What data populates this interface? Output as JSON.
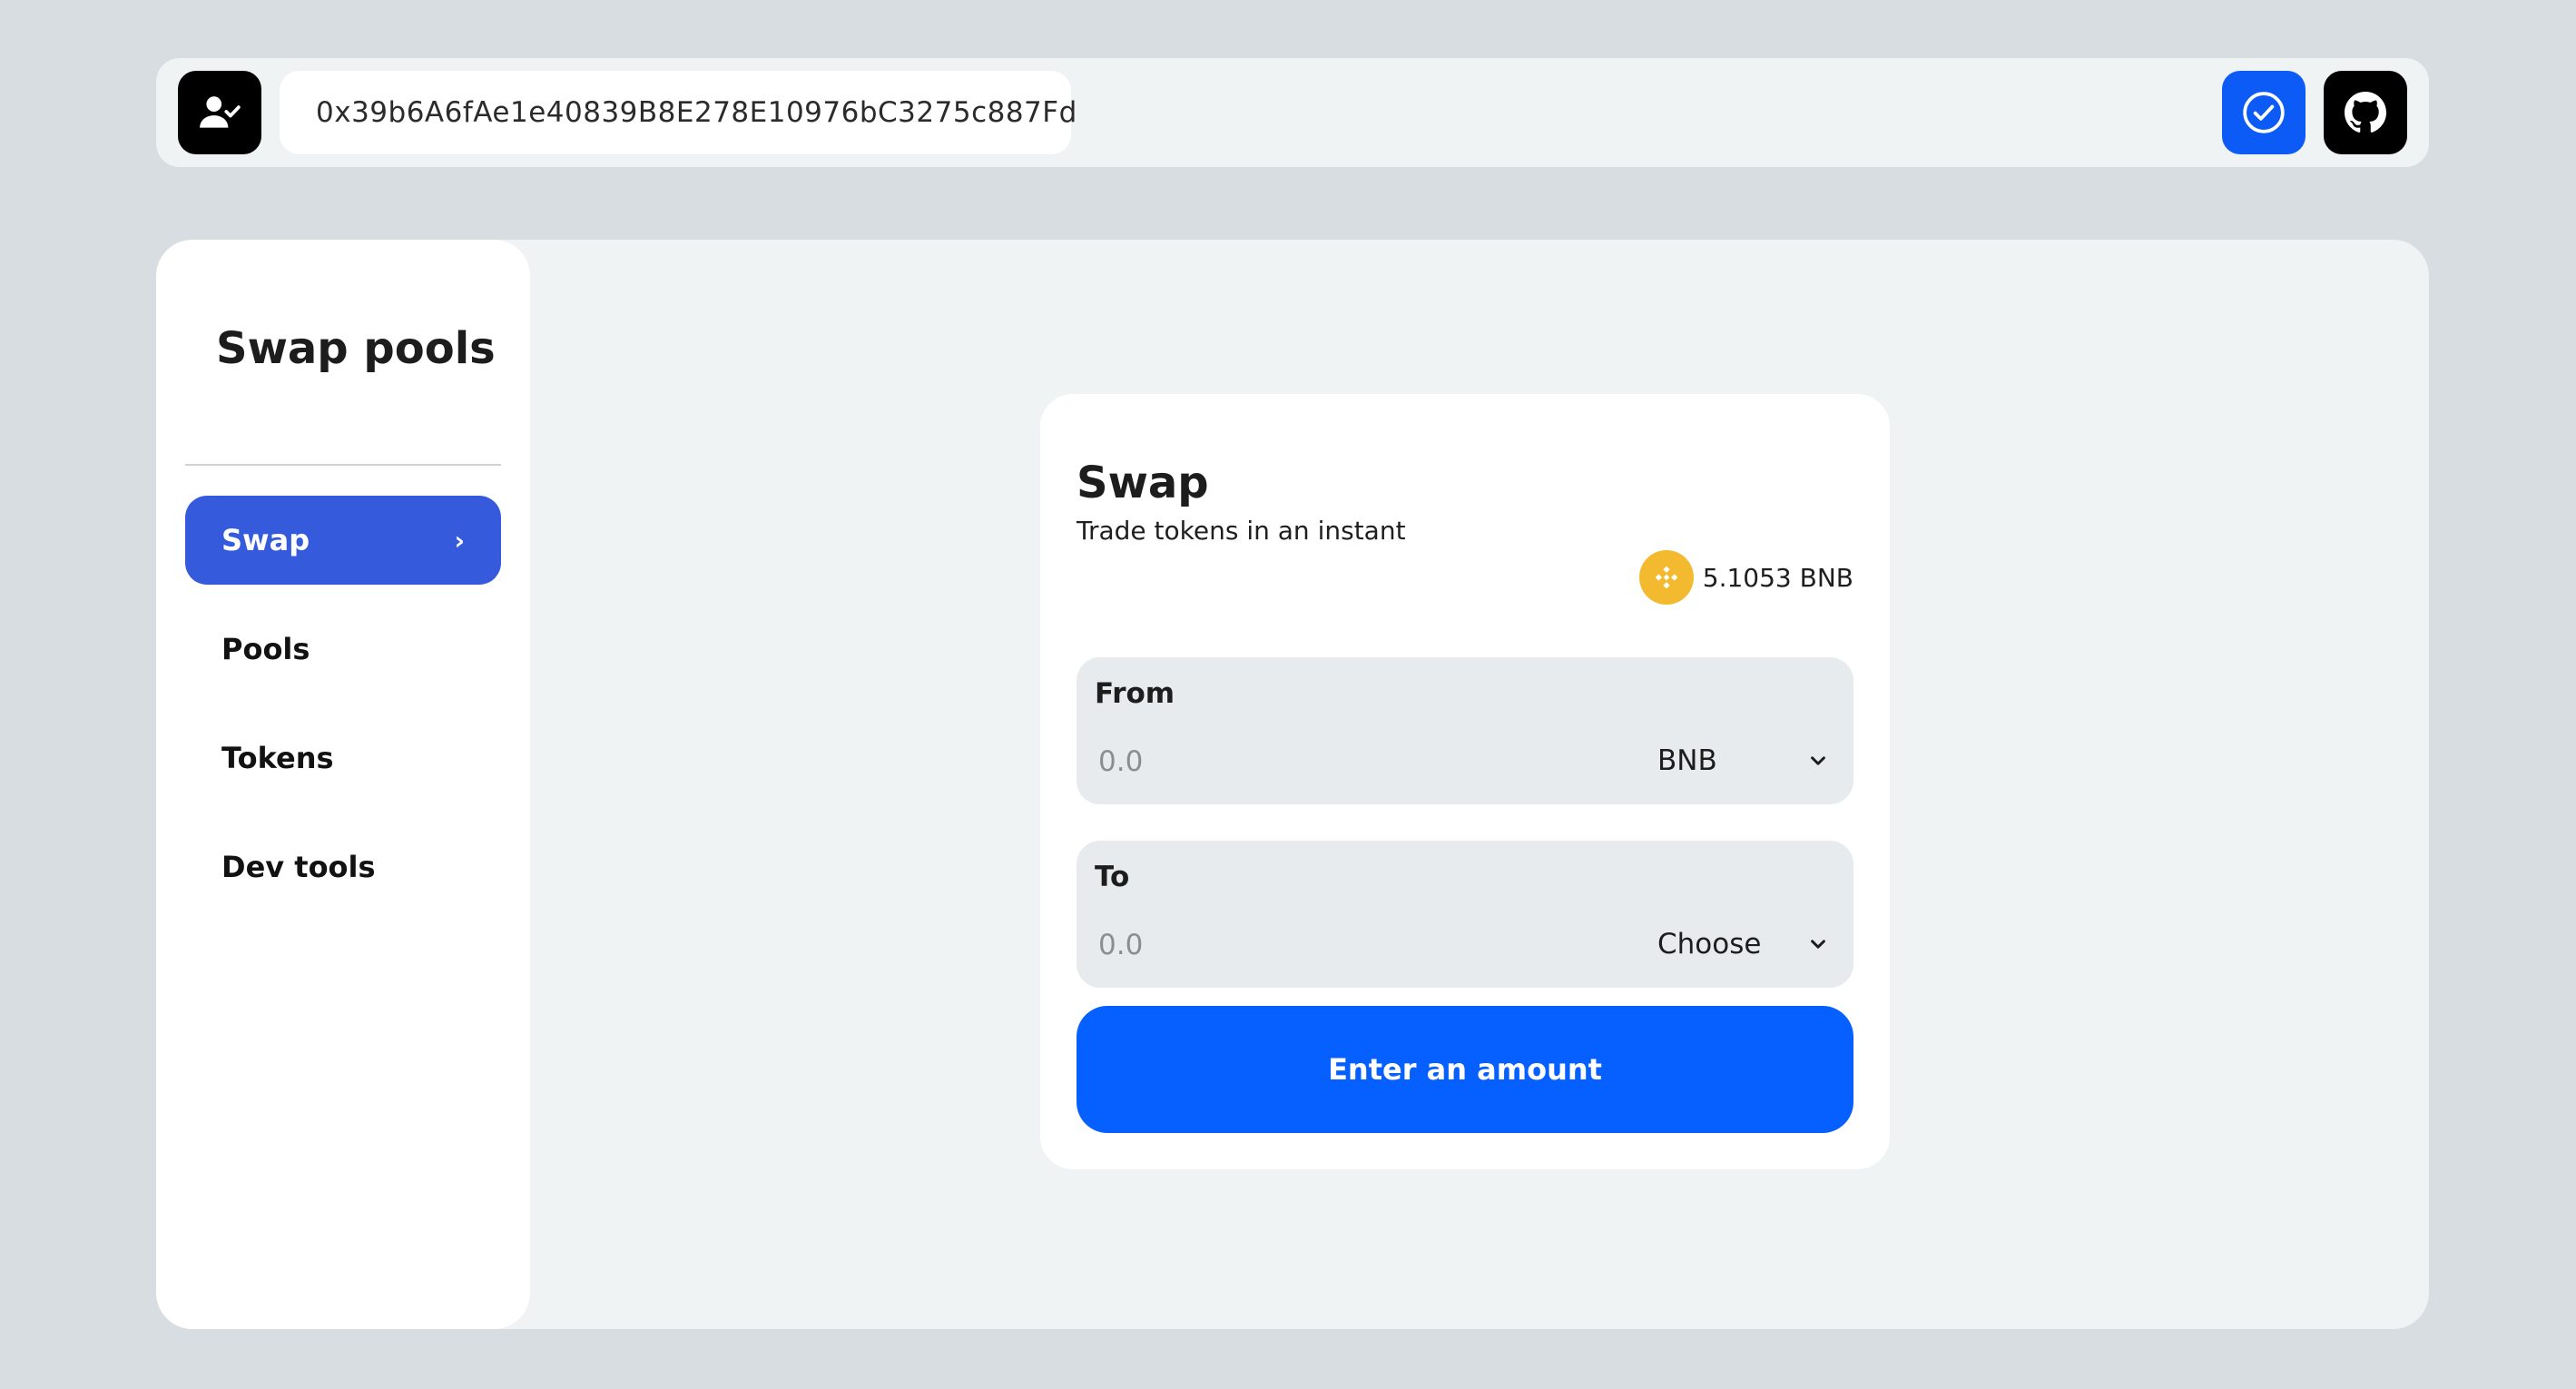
{
  "header": {
    "address": "0x39b6A6fAe1e40839B8E278E10976bC3275c887Fd",
    "icons": {
      "account": "user-check-icon",
      "verified": "check-circle-icon",
      "github": "github-icon"
    }
  },
  "sidebar": {
    "title": "Swap pools",
    "items": [
      {
        "label": "Swap",
        "active": true
      },
      {
        "label": "Pools",
        "active": false
      },
      {
        "label": "Tokens",
        "active": false
      },
      {
        "label": "Dev tools",
        "active": false
      }
    ]
  },
  "swap": {
    "title": "Swap",
    "subtitle": "Trade tokens in an instant",
    "balance": "5.1053 BNB",
    "from": {
      "label": "From",
      "placeholder": "0.0",
      "token": "BNB"
    },
    "to": {
      "label": "To",
      "placeholder": "0.0",
      "token": "Choose"
    },
    "button_label": "Enter an amount"
  },
  "colors": {
    "background": "#d8dde1",
    "panel": "#f0f3f4",
    "accent": "#0560ff",
    "nav_active": "#355bdc",
    "bnb": "#f3ba2f"
  }
}
